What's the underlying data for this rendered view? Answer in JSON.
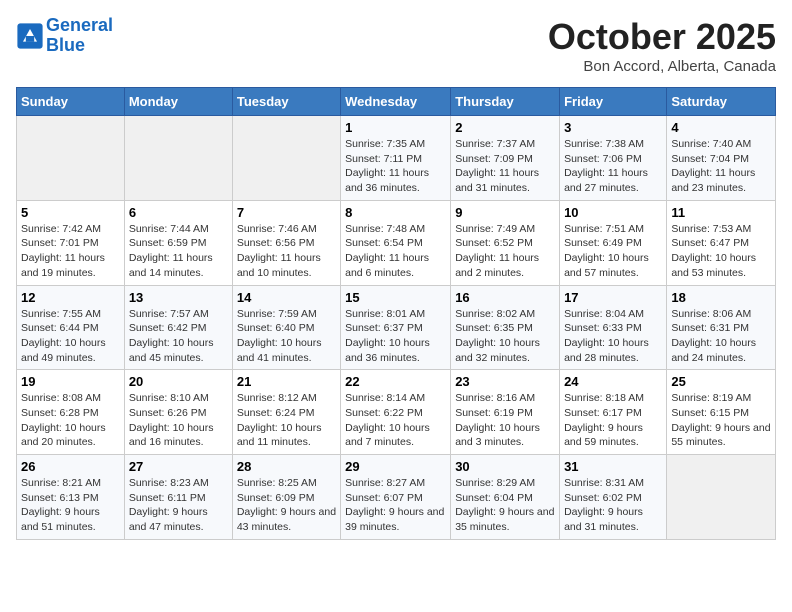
{
  "header": {
    "logo_line1": "General",
    "logo_line2": "Blue",
    "month": "October 2025",
    "location": "Bon Accord, Alberta, Canada"
  },
  "days_of_week": [
    "Sunday",
    "Monday",
    "Tuesday",
    "Wednesday",
    "Thursday",
    "Friday",
    "Saturday"
  ],
  "weeks": [
    [
      {
        "day": "",
        "sunrise": "",
        "sunset": "",
        "daylight": ""
      },
      {
        "day": "",
        "sunrise": "",
        "sunset": "",
        "daylight": ""
      },
      {
        "day": "",
        "sunrise": "",
        "sunset": "",
        "daylight": ""
      },
      {
        "day": "1",
        "sunrise": "Sunrise: 7:35 AM",
        "sunset": "Sunset: 7:11 PM",
        "daylight": "Daylight: 11 hours and 36 minutes."
      },
      {
        "day": "2",
        "sunrise": "Sunrise: 7:37 AM",
        "sunset": "Sunset: 7:09 PM",
        "daylight": "Daylight: 11 hours and 31 minutes."
      },
      {
        "day": "3",
        "sunrise": "Sunrise: 7:38 AM",
        "sunset": "Sunset: 7:06 PM",
        "daylight": "Daylight: 11 hours and 27 minutes."
      },
      {
        "day": "4",
        "sunrise": "Sunrise: 7:40 AM",
        "sunset": "Sunset: 7:04 PM",
        "daylight": "Daylight: 11 hours and 23 minutes."
      }
    ],
    [
      {
        "day": "5",
        "sunrise": "Sunrise: 7:42 AM",
        "sunset": "Sunset: 7:01 PM",
        "daylight": "Daylight: 11 hours and 19 minutes."
      },
      {
        "day": "6",
        "sunrise": "Sunrise: 7:44 AM",
        "sunset": "Sunset: 6:59 PM",
        "daylight": "Daylight: 11 hours and 14 minutes."
      },
      {
        "day": "7",
        "sunrise": "Sunrise: 7:46 AM",
        "sunset": "Sunset: 6:56 PM",
        "daylight": "Daylight: 11 hours and 10 minutes."
      },
      {
        "day": "8",
        "sunrise": "Sunrise: 7:48 AM",
        "sunset": "Sunset: 6:54 PM",
        "daylight": "Daylight: 11 hours and 6 minutes."
      },
      {
        "day": "9",
        "sunrise": "Sunrise: 7:49 AM",
        "sunset": "Sunset: 6:52 PM",
        "daylight": "Daylight: 11 hours and 2 minutes."
      },
      {
        "day": "10",
        "sunrise": "Sunrise: 7:51 AM",
        "sunset": "Sunset: 6:49 PM",
        "daylight": "Daylight: 10 hours and 57 minutes."
      },
      {
        "day": "11",
        "sunrise": "Sunrise: 7:53 AM",
        "sunset": "Sunset: 6:47 PM",
        "daylight": "Daylight: 10 hours and 53 minutes."
      }
    ],
    [
      {
        "day": "12",
        "sunrise": "Sunrise: 7:55 AM",
        "sunset": "Sunset: 6:44 PM",
        "daylight": "Daylight: 10 hours and 49 minutes."
      },
      {
        "day": "13",
        "sunrise": "Sunrise: 7:57 AM",
        "sunset": "Sunset: 6:42 PM",
        "daylight": "Daylight: 10 hours and 45 minutes."
      },
      {
        "day": "14",
        "sunrise": "Sunrise: 7:59 AM",
        "sunset": "Sunset: 6:40 PM",
        "daylight": "Daylight: 10 hours and 41 minutes."
      },
      {
        "day": "15",
        "sunrise": "Sunrise: 8:01 AM",
        "sunset": "Sunset: 6:37 PM",
        "daylight": "Daylight: 10 hours and 36 minutes."
      },
      {
        "day": "16",
        "sunrise": "Sunrise: 8:02 AM",
        "sunset": "Sunset: 6:35 PM",
        "daylight": "Daylight: 10 hours and 32 minutes."
      },
      {
        "day": "17",
        "sunrise": "Sunrise: 8:04 AM",
        "sunset": "Sunset: 6:33 PM",
        "daylight": "Daylight: 10 hours and 28 minutes."
      },
      {
        "day": "18",
        "sunrise": "Sunrise: 8:06 AM",
        "sunset": "Sunset: 6:31 PM",
        "daylight": "Daylight: 10 hours and 24 minutes."
      }
    ],
    [
      {
        "day": "19",
        "sunrise": "Sunrise: 8:08 AM",
        "sunset": "Sunset: 6:28 PM",
        "daylight": "Daylight: 10 hours and 20 minutes."
      },
      {
        "day": "20",
        "sunrise": "Sunrise: 8:10 AM",
        "sunset": "Sunset: 6:26 PM",
        "daylight": "Daylight: 10 hours and 16 minutes."
      },
      {
        "day": "21",
        "sunrise": "Sunrise: 8:12 AM",
        "sunset": "Sunset: 6:24 PM",
        "daylight": "Daylight: 10 hours and 11 minutes."
      },
      {
        "day": "22",
        "sunrise": "Sunrise: 8:14 AM",
        "sunset": "Sunset: 6:22 PM",
        "daylight": "Daylight: 10 hours and 7 minutes."
      },
      {
        "day": "23",
        "sunrise": "Sunrise: 8:16 AM",
        "sunset": "Sunset: 6:19 PM",
        "daylight": "Daylight: 10 hours and 3 minutes."
      },
      {
        "day": "24",
        "sunrise": "Sunrise: 8:18 AM",
        "sunset": "Sunset: 6:17 PM",
        "daylight": "Daylight: 9 hours and 59 minutes."
      },
      {
        "day": "25",
        "sunrise": "Sunrise: 8:19 AM",
        "sunset": "Sunset: 6:15 PM",
        "daylight": "Daylight: 9 hours and 55 minutes."
      }
    ],
    [
      {
        "day": "26",
        "sunrise": "Sunrise: 8:21 AM",
        "sunset": "Sunset: 6:13 PM",
        "daylight": "Daylight: 9 hours and 51 minutes."
      },
      {
        "day": "27",
        "sunrise": "Sunrise: 8:23 AM",
        "sunset": "Sunset: 6:11 PM",
        "daylight": "Daylight: 9 hours and 47 minutes."
      },
      {
        "day": "28",
        "sunrise": "Sunrise: 8:25 AM",
        "sunset": "Sunset: 6:09 PM",
        "daylight": "Daylight: 9 hours and 43 minutes."
      },
      {
        "day": "29",
        "sunrise": "Sunrise: 8:27 AM",
        "sunset": "Sunset: 6:07 PM",
        "daylight": "Daylight: 9 hours and 39 minutes."
      },
      {
        "day": "30",
        "sunrise": "Sunrise: 8:29 AM",
        "sunset": "Sunset: 6:04 PM",
        "daylight": "Daylight: 9 hours and 35 minutes."
      },
      {
        "day": "31",
        "sunrise": "Sunrise: 8:31 AM",
        "sunset": "Sunset: 6:02 PM",
        "daylight": "Daylight: 9 hours and 31 minutes."
      },
      {
        "day": "",
        "sunrise": "",
        "sunset": "",
        "daylight": ""
      }
    ]
  ]
}
